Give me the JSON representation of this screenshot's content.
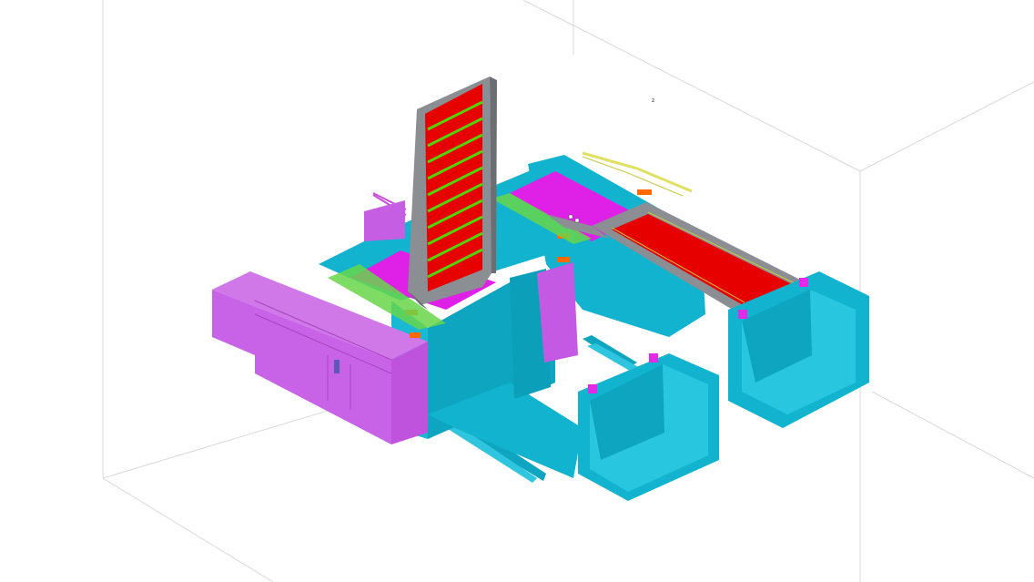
{
  "viewport": {
    "background": "#ffffff",
    "axis_marker_label": "z"
  },
  "colors": {
    "cyan": "#12b3cf",
    "cyan_dark": "#0896b2",
    "cyan_light": "#29c6df",
    "magenta": "#d931e0",
    "magenta_light": "#c65ee4",
    "red": "#e60000",
    "green": "#53d400",
    "gray": "#8b8e93",
    "gray_dark": "#6b6e72",
    "orange": "#ff6a00",
    "yellow": "#e0e062",
    "grid_line": "#d9d9d9"
  },
  "model": {
    "components": [
      "room-box",
      "left-building",
      "central-chamber",
      "vertical-stair-ladder",
      "inclined-ramp",
      "right-pit-block",
      "bottom-pit-block",
      "conveyor-beams"
    ]
  }
}
